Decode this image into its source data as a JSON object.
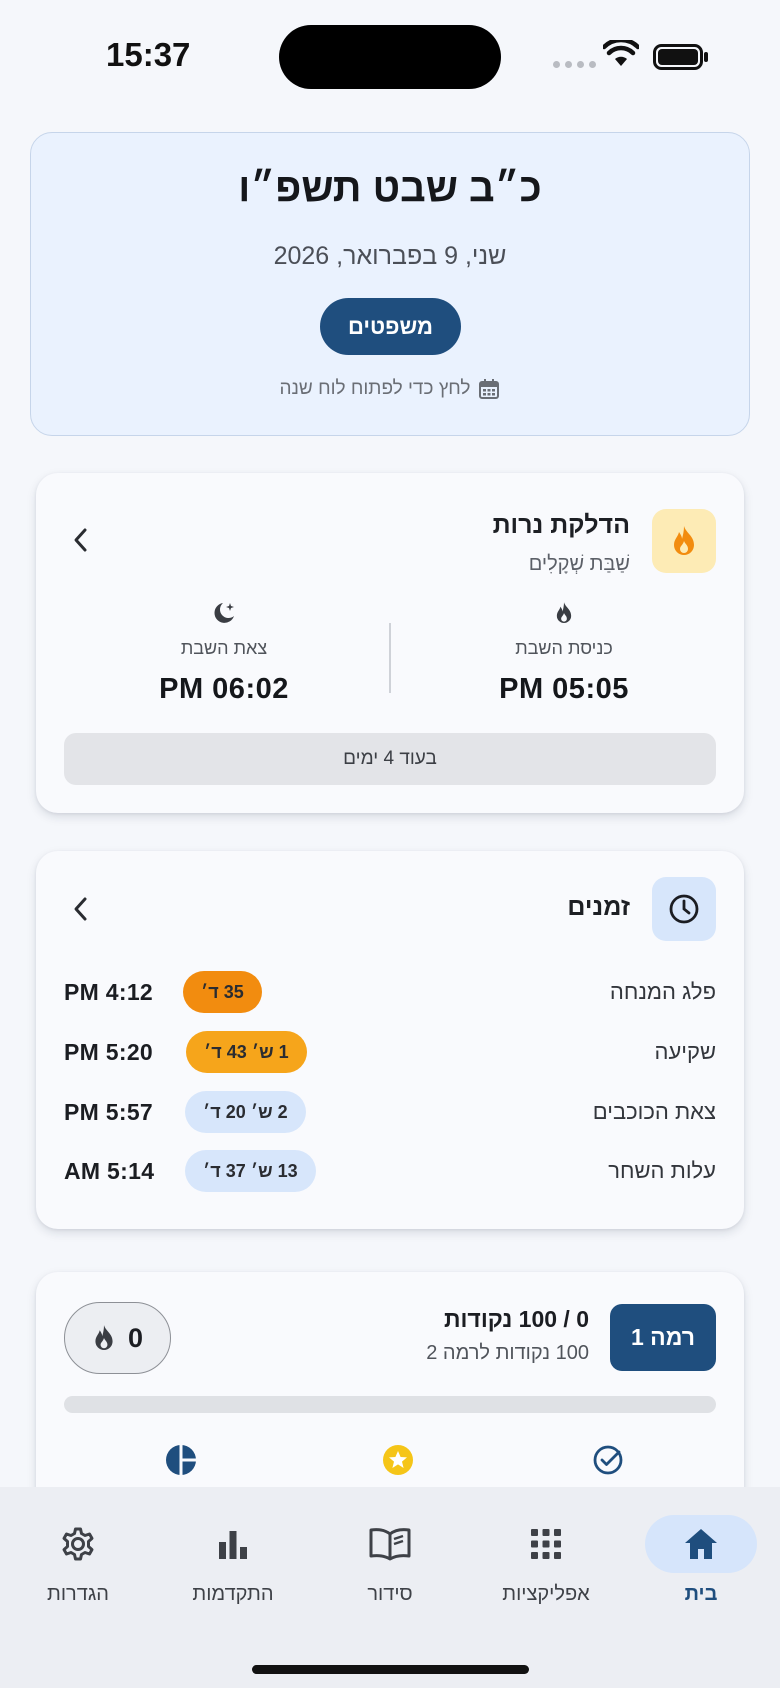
{
  "status_bar": {
    "time": "15:37"
  },
  "date_card": {
    "hebrew_date": "כ״ב שבט תשפ״ו",
    "gregorian_date": "שני, 9 בפברואר, 2026",
    "parasha_button": "משפטים",
    "calendar_hint": "לחץ כדי לפתוח לוח שנה"
  },
  "candles": {
    "title": "הדלקת נרות",
    "subtitle": "שַׁבַּת שְׁקָלִים",
    "entry_label": "כניסת השבת",
    "entry_time": "PM 05:05",
    "exit_label": "צאת השבת",
    "exit_time": "PM 06:02",
    "countdown": "בעוד 4 ימים"
  },
  "zmanim": {
    "title": "זמנים",
    "rows": [
      {
        "name": "פלג המנחה",
        "badge": "35 ד׳",
        "time": "PM 4:12",
        "badge_color": "#f28c0f"
      },
      {
        "name": "שקיעה",
        "badge": "1 ש׳ 43 ד׳",
        "time": "PM 5:20",
        "badge_color": "#f6a51b"
      },
      {
        "name": "צאת הכוכבים",
        "badge": "2 ש׳ 20 ד׳",
        "time": "PM 5:57",
        "badge_color": "#d7e6fb"
      },
      {
        "name": "עלות השחר",
        "badge": "13 ש׳ 37 ד׳",
        "time": "AM 5:14",
        "badge_color": "#d7e6fb"
      }
    ]
  },
  "level": {
    "badge": "רמה 1",
    "points": "0 / 100 נקודות",
    "points_to_next": "100 נקודות לרמה 2",
    "streak": "0",
    "progress": 0
  },
  "nav": {
    "items": [
      {
        "label": "בית",
        "icon": "home-icon",
        "active": true
      },
      {
        "label": "אפליקציות",
        "icon": "apps-grid-icon",
        "active": false
      },
      {
        "label": "סידור",
        "icon": "book-icon",
        "active": false
      },
      {
        "label": "התקדמות",
        "icon": "bar-chart-icon",
        "active": false
      },
      {
        "label": "הגדרות",
        "icon": "gear-icon",
        "active": false
      }
    ]
  },
  "colors": {
    "primary": "#1f4e7e",
    "accent_orange": "#f28c0f",
    "light_blue": "#d7e6fb",
    "candle_icon_bg": "#fdebb5"
  }
}
